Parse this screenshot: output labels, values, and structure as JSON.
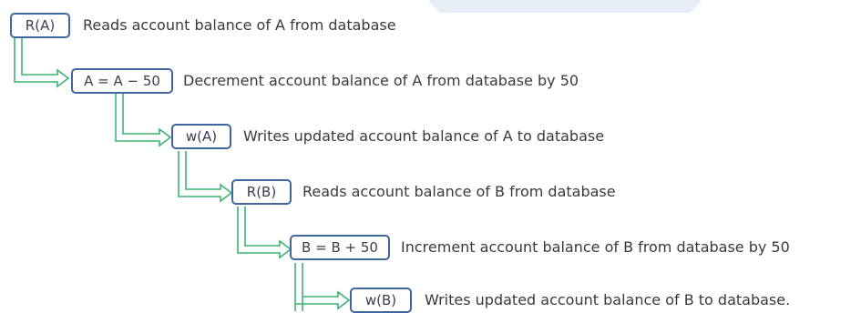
{
  "steps": [
    {
      "op": "R(A)",
      "desc": "Reads account balance of A from database"
    },
    {
      "op": "A = A − 50",
      "desc": "Decrement account balance of A from database by 50"
    },
    {
      "op": "w(A)",
      "desc": "Writes updated account balance of A to database"
    },
    {
      "op": "R(B)",
      "desc": "Reads account balance of B from database"
    },
    {
      "op": "B = B + 50",
      "desc": "Increment account balance of B from database by 50"
    },
    {
      "op": "w(B)",
      "desc": "Writes updated account balance of B to database."
    }
  ],
  "colors": {
    "box_border": "#3f679e",
    "arrow": "#3cb371",
    "text": "#3a3a3a"
  }
}
